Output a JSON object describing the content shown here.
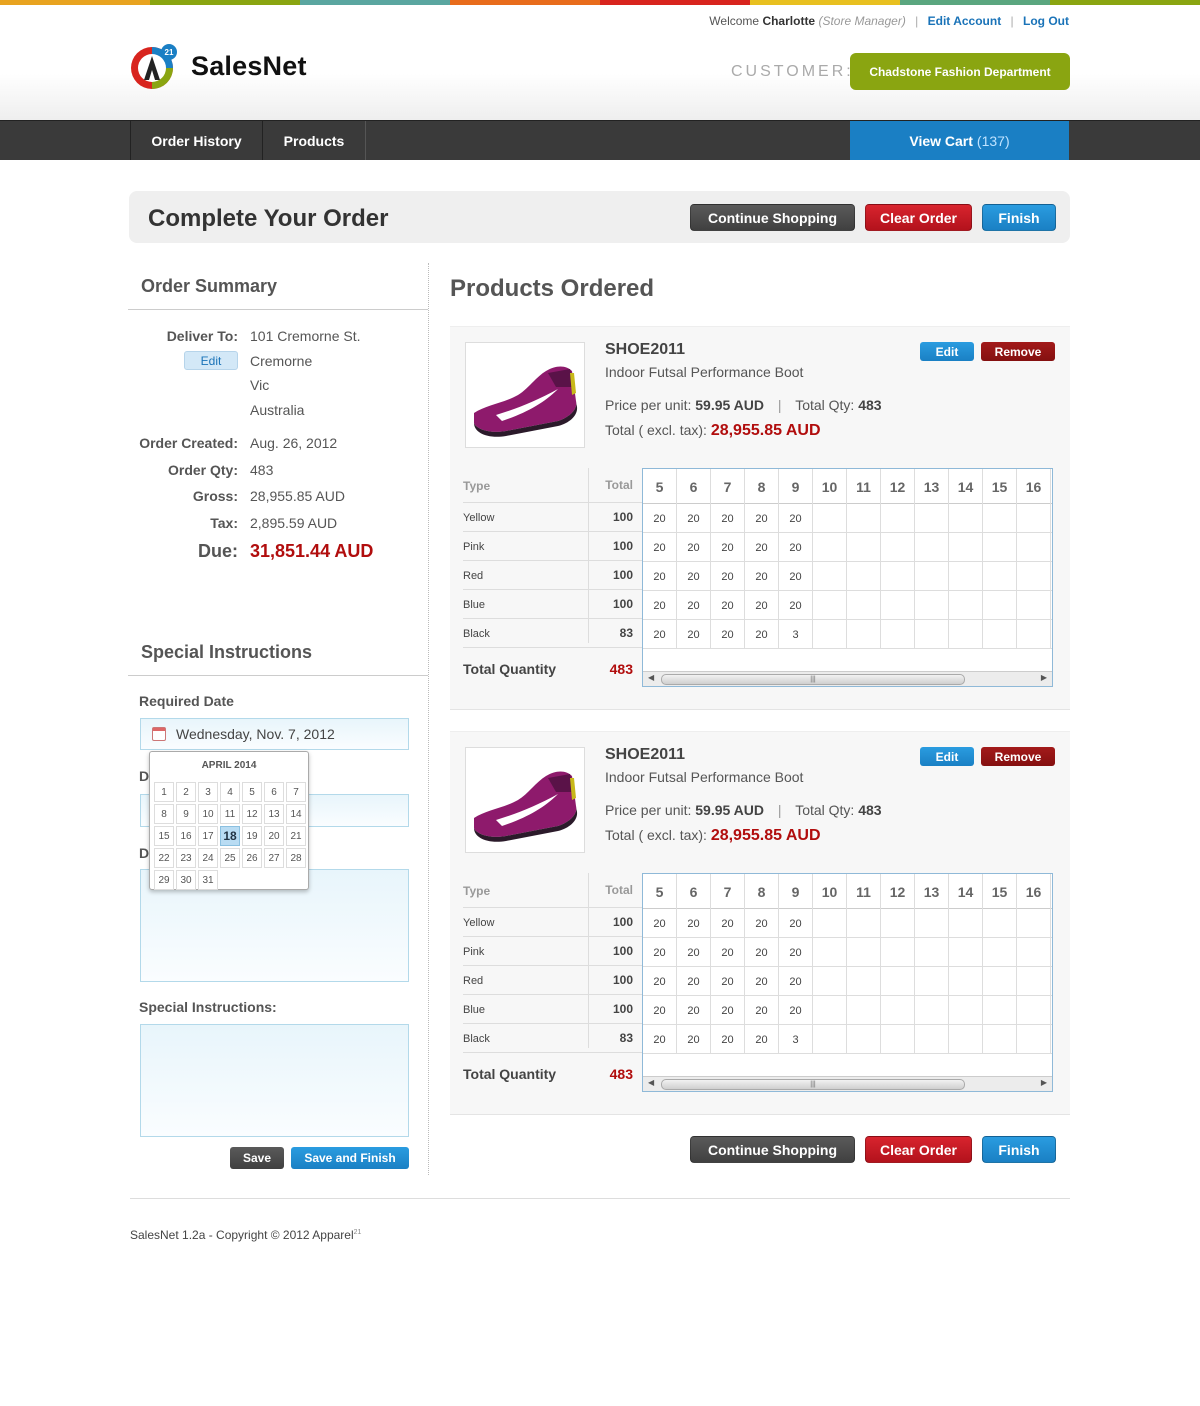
{
  "colors": {
    "stripe": [
      "#e8a320",
      "#8aa511",
      "#5aa6a0",
      "#e86c1c",
      "#d8241e",
      "#e8c020",
      "#5aa67f",
      "#8aa511"
    ],
    "accent_blue": "#1a7fc4",
    "accent_green": "#8aa511",
    "due_red": "#b10d0d"
  },
  "brand": {
    "name": "SalesNet",
    "logo_badge": "21"
  },
  "userbar": {
    "welcome": "Welcome",
    "user_name": "Charlotte",
    "role": "(Store Manager)",
    "edit_account": "Edit Account",
    "log_out": "Log Out"
  },
  "customer": {
    "label": "CUSTOMER:",
    "name": "Chadstone Fashion Department"
  },
  "nav": {
    "items": [
      {
        "label": "Order History"
      },
      {
        "label": "Products"
      }
    ],
    "cart_label": "View Cart",
    "cart_count": "(137)"
  },
  "page": {
    "title": "Complete Your Order",
    "actions": {
      "continue": "Continue Shopping",
      "clear": "Clear Order",
      "finish": "Finish"
    }
  },
  "summary": {
    "heading": "Order Summary",
    "deliver_label": "Deliver To:",
    "edit": "Edit",
    "address": [
      "101 Cremorne St.",
      "Cremorne",
      "Vic",
      "Australia"
    ],
    "created_label": "Order Created:",
    "created": "Aug. 26, 2012",
    "qty_label": "Order Qty:",
    "qty": "483",
    "gross_label": "Gross:",
    "gross": "28,955.85 AUD",
    "tax_label": "Tax:",
    "tax": "2,895.59 AUD",
    "due_label": "Due:",
    "due": "31,851.44 AUD"
  },
  "instructions": {
    "heading": "Special Instructions",
    "required_date_label": "Required Date",
    "required_date": "Wednesday, Nov. 7, 2012",
    "hidden_label_1": "D",
    "hidden_label_2": "D",
    "special_label": "Special Instructions:",
    "save": "Save",
    "save_finish": "Save and Finish"
  },
  "calendar": {
    "month": "APRIL 2014",
    "days": [
      "1",
      "2",
      "3",
      "4",
      "5",
      "6",
      "7",
      "8",
      "9",
      "10",
      "11",
      "12",
      "13",
      "14",
      "15",
      "16",
      "17",
      "18",
      "19",
      "20",
      "21",
      "22",
      "23",
      "24",
      "25",
      "26",
      "27",
      "28",
      "29",
      "30",
      "31"
    ],
    "selected": "18"
  },
  "products": {
    "heading": "Products Ordered",
    "edit": "Edit",
    "remove": "Remove",
    "type_header": "Type",
    "total_header": "Total",
    "total_qty_label": "Total Quantity",
    "sizes": [
      "5",
      "6",
      "7",
      "8",
      "9",
      "10",
      "11",
      "12",
      "13",
      "14",
      "15",
      "16"
    ],
    "items": [
      {
        "sku": "SHOE2011",
        "name": "Indoor Futsal Performance Boot",
        "price_label": "Price per unit:",
        "price": "59.95 AUD",
        "qty_label": "Total Qty:",
        "qty": "483",
        "total_label": "Total ( excl. tax):",
        "total": "28,955.85 AUD",
        "total_qty": "483",
        "rows": [
          {
            "type": "Yellow",
            "total": "100",
            "cells": [
              "20",
              "20",
              "20",
              "20",
              "20",
              "",
              "",
              "",
              "",
              "",
              "",
              ""
            ]
          },
          {
            "type": "Pink",
            "total": "100",
            "cells": [
              "20",
              "20",
              "20",
              "20",
              "20",
              "",
              "",
              "",
              "",
              "",
              "",
              ""
            ]
          },
          {
            "type": "Red",
            "total": "100",
            "cells": [
              "20",
              "20",
              "20",
              "20",
              "20",
              "",
              "",
              "",
              "",
              "",
              "",
              ""
            ]
          },
          {
            "type": "Blue",
            "total": "100",
            "cells": [
              "20",
              "20",
              "20",
              "20",
              "20",
              "",
              "",
              "",
              "",
              "",
              "",
              ""
            ]
          },
          {
            "type": "Black",
            "total": "83",
            "cells": [
              "20",
              "20",
              "20",
              "20",
              "3",
              "",
              "",
              "",
              "",
              "",
              "",
              ""
            ]
          }
        ]
      },
      {
        "sku": "SHOE2011",
        "name": "Indoor Futsal Performance Boot",
        "price_label": "Price per unit:",
        "price": "59.95 AUD",
        "qty_label": "Total Qty:",
        "qty": "483",
        "total_label": "Total ( excl. tax):",
        "total": "28,955.85 AUD",
        "total_qty": "483",
        "rows": [
          {
            "type": "Yellow",
            "total": "100",
            "cells": [
              "20",
              "20",
              "20",
              "20",
              "20",
              "",
              "",
              "",
              "",
              "",
              "",
              ""
            ]
          },
          {
            "type": "Pink",
            "total": "100",
            "cells": [
              "20",
              "20",
              "20",
              "20",
              "20",
              "",
              "",
              "",
              "",
              "",
              "",
              ""
            ]
          },
          {
            "type": "Red",
            "total": "100",
            "cells": [
              "20",
              "20",
              "20",
              "20",
              "20",
              "",
              "",
              "",
              "",
              "",
              "",
              ""
            ]
          },
          {
            "type": "Blue",
            "total": "100",
            "cells": [
              "20",
              "20",
              "20",
              "20",
              "20",
              "",
              "",
              "",
              "",
              "",
              "",
              ""
            ]
          },
          {
            "type": "Black",
            "total": "83",
            "cells": [
              "20",
              "20",
              "20",
              "20",
              "3",
              "",
              "",
              "",
              "",
              "",
              "",
              ""
            ]
          }
        ]
      }
    ]
  },
  "footer": {
    "text": "SalesNet 1.2a - Copyright © 2012 Apparel",
    "sup": "21"
  }
}
